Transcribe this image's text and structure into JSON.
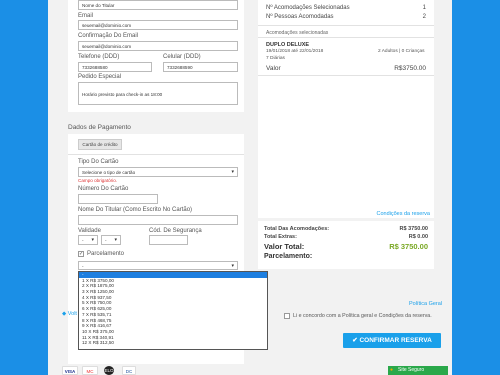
{
  "form": {
    "holder_name_value": "Nome do Titular",
    "email_label": "Email",
    "email_value": "seuemail@dominio.com",
    "confirm_email_label": "Confirmação Do Email",
    "confirm_email_value": "seuemail@dominio.com",
    "phone_label": "Telefone (DDD)",
    "phone_value": "7332688580",
    "cell_label": "Celular (DDD)",
    "cell_value": "7332688590",
    "special_request_label": "Pedido Especial",
    "special_request_value": "Horário previsto para check-in as 18:00"
  },
  "payment": {
    "section_title": "Dados de Pagamento",
    "tab_credit_card": "Cartão de crédito",
    "card_type_label": "Tipo Do Cartão",
    "card_type_select": "Selecione o tipo de cartão",
    "required_error": "Campo obrigatório.",
    "card_number_label": "Número Do Cartão",
    "card_holder_label": "Nome Do Titular (Como Escrito No Cartão)",
    "validity_label": "Validade",
    "month_value": "-",
    "year_value": "-",
    "security_code_label": "Cód. De Segurança",
    "installments_label": "Parcelamento",
    "installments_selected": "-",
    "installment_options": [
      "-",
      "1 X R$ 3750,00",
      "2 X R$ 1875,00",
      "3 X R$ 1250,00",
      "4 X R$ 937,50",
      "5 X R$ 750,00",
      "6 X R$ 625,00",
      "7 X R$ 535,71",
      "8 X R$ 468,75",
      "9 X R$ 416,67",
      "10 X R$ 375,00",
      "11 X R$ 340,91",
      "12 X R$ 312,50"
    ]
  },
  "summary": {
    "rooms_selected_label": "Nº Acomodações Selecionadas",
    "rooms_selected_value": "1",
    "guests_label": "Nº Pessoas Acomodadas",
    "guests_value": "2",
    "selected_rooms_title": "Acomodações selecionadas",
    "room_name": "DUPLO DELUXE",
    "room_dates": "19/01/2018 até 22/01/2018",
    "room_nights": "7 Diárias",
    "room_guests": "2 Adultos | 0 Crianças",
    "value_label": "Valor",
    "value_amount": "R$3750.00",
    "conditions_link": "Condições da reserva",
    "total_rooms_label": "Total Das Acomodações:",
    "total_rooms_value": "R$ 3750.00",
    "extras_label": "Total Extras:",
    "extras_value": "R$ 0.00",
    "total_label": "Valor Total:",
    "total_value": "R$ 3750.00",
    "installments_label": "Parcelamento:"
  },
  "footer": {
    "back_link": "Volt",
    "policy_link": "Política Geral",
    "agree_text": "Li e concordo com a Política geral e Condições da reserva.",
    "confirm_button": "CONFIRMAR RESERVA",
    "secure_badge": "Site Seguro",
    "payment_icons": [
      "VISA",
      "MC",
      "ELO",
      "DC"
    ]
  },
  "colors": {
    "accent_blue": "#1aa0ea",
    "background_blue": "#1b8fe6",
    "total_green": "#7aa824",
    "error_red": "#dd3333"
  }
}
